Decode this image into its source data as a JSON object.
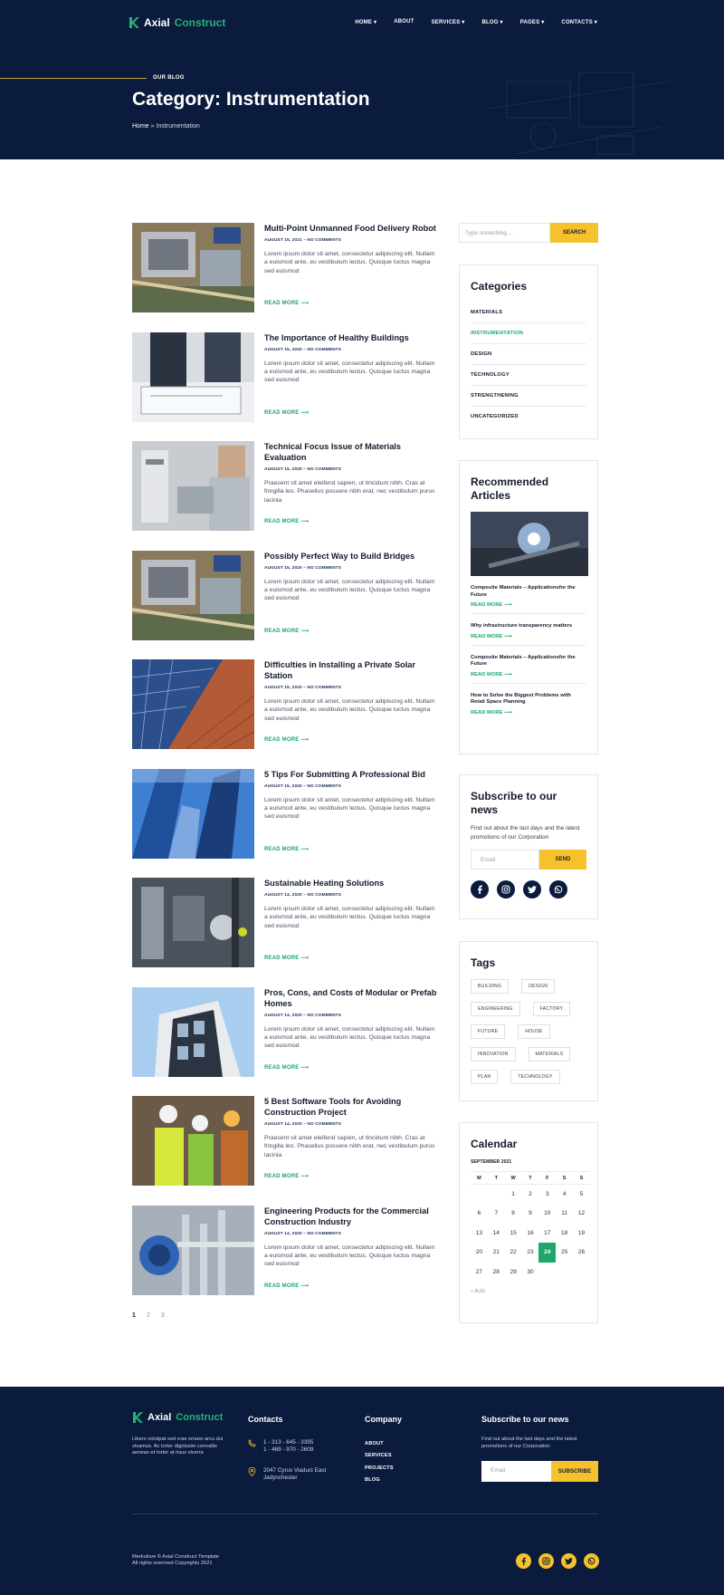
{
  "brand": {
    "name_part1": "Axial",
    "name_part2": "Construct"
  },
  "nav": {
    "home": "HOME",
    "about": "ABOUT",
    "services": "SERVICES",
    "blog": "BLOG",
    "pages": "PAGES",
    "contacts": "CONTACTS"
  },
  "hero": {
    "eyebrow": "OUR BLOG",
    "title": "Category: Instrumentation",
    "breadcrumb_home": "Home",
    "breadcrumb_sep": "»",
    "breadcrumb_current": "Instrumentation"
  },
  "posts": [
    {
      "title": "Multi-Point Unmanned Food Delivery Robot",
      "date": "AUGUST 15, 2021",
      "comments": "NO COMMENTS",
      "excerpt": "Lorem ipsum dolor sit amet, consectetur adipiscing elit. Nullam a euismod ante, eu vestibulum lectus. Quisque luctus magna sed euismod",
      "more": "READ MORE"
    },
    {
      "title": "The Importance of Healthy Buildings",
      "date": "AUGUST 15, 2020",
      "comments": "NO COMMENTS",
      "excerpt": "Lorem ipsum dolor sit amet, consectetur adipiscing elit. Nullam a euismod ante, eu vestibulum lectus. Quisque luctus magna sed euismod",
      "more": "READ MORE"
    },
    {
      "title": "Technical Focus Issue of Materials Evaluation",
      "date": "AUGUST 15, 2020",
      "comments": "NO COMMENTS",
      "excerpt": "Praesent sit amet eleifend sapien, ut tincidunt nibh. Cras at fringilla leo. Phasellus posuere nibh erat, nec vestibulum purus lacinia",
      "more": "READ MORE"
    },
    {
      "title": "Possibly Perfect Way to Build Bridges",
      "date": "AUGUST 15, 2020",
      "comments": "NO COMMENTS",
      "excerpt": "Lorem ipsum dolor sit amet, consectetur adipiscing elit. Nullam a euismod ante, eu vestibulum lectus. Quisque luctus magna sed euismod",
      "more": "READ MORE"
    },
    {
      "title": "Difficulties in Installing a Private Solar Station",
      "date": "AUGUST 15, 2020",
      "comments": "NO COMMENTS",
      "excerpt": "Lorem ipsum dolor sit amet, consectetur adipiscing elit. Nullam a euismod ante, eu vestibulum lectus. Quisque luctus magna sed euismod",
      "more": "READ MORE"
    },
    {
      "title": "5 Tips For Submitting A Professional Bid",
      "date": "AUGUST 15, 2020",
      "comments": "NO COMMENTS",
      "excerpt": "Lorem ipsum dolor sit amet, consectetur adipiscing elit. Nullam a euismod ante, eu vestibulum lectus. Quisque luctus magna sed euismod",
      "more": "READ MORE"
    },
    {
      "title": "Sustainable Heating Solutions",
      "date": "AUGUST 14, 2020",
      "comments": "NO COMMENTS",
      "excerpt": "Lorem ipsum dolor sit amet, consectetur adipiscing elit. Nullam a euismod ante, eu vestibulum lectus. Quisque luctus magna sed euismod",
      "more": "READ MORE"
    },
    {
      "title": "Pros, Cons, and Costs of Modular or Prefab Homes",
      "date": "AUGUST 14, 2020",
      "comments": "NO COMMENTS",
      "excerpt": "Lorem ipsum dolor sit amet, consectetur adipiscing elit. Nullam a euismod ante, eu vestibulum lectus. Quisque luctus magna sed euismod",
      "more": "READ MORE"
    },
    {
      "title": "5 Best Software Tools for Avoiding Construction Project",
      "date": "AUGUST 14, 2020",
      "comments": "NO COMMENTS",
      "excerpt": "Praesent sit amet eleifend sapien, ut tincidunt nibh. Cras at fringilla leo. Phasellus posuere nibh erat, nec vestibulum purus lacinia",
      "more": "READ MORE"
    },
    {
      "title": "Engineering Products for the Commercial Construction Industry",
      "date": "AUGUST 14, 2020",
      "comments": "NO COMMENTS",
      "excerpt": "Lorem ipsum dolor sit amet, consectetur adipiscing elit. Nullam a euismod ante, eu vestibulum lectus. Quisque luctus magna sed euismod",
      "more": "READ MORE"
    }
  ],
  "pagination": [
    "1",
    "2",
    "3"
  ],
  "search": {
    "placeholder": "Type something ...",
    "button": "SEARCH"
  },
  "categories": {
    "title": "Categories",
    "items": [
      "MATERIALS",
      "INSTRUMENTATION",
      "DESIGN",
      "TECHNOLOGY",
      "STRENGTHENING",
      "UNCATEGORIZED"
    ]
  },
  "recommended": {
    "title": "Recommended Articles",
    "more": "READ MORE",
    "items": [
      "Composite Materials – Applicationsfor the Future",
      "Why infrastructure transparency matters",
      "Composite Materials – Applicationsfor the Future",
      "How to Solve the Biggest Problems with Retail Space Planning"
    ]
  },
  "subscribe": {
    "title": "Subscribe to our news",
    "text": "Find out about the last days and the latest promotions of our Corporation",
    "placeholder": "Email",
    "button": "SEND"
  },
  "tags": {
    "title": "Tags",
    "items": [
      "BUILDING",
      "DESIGN",
      "ENGINEERING",
      "FACTORY",
      "FUTURE",
      "HOUSE",
      "INNOVATION",
      "MATERIALS",
      "PLAN",
      "TECHNOLOGY"
    ]
  },
  "calendar": {
    "title": "Calendar",
    "month": "SEPTEMBER 2021",
    "days": [
      "M",
      "T",
      "W",
      "T",
      "F",
      "S",
      "S"
    ],
    "today": "24",
    "prev": "« AUG",
    "weeks": [
      [
        "",
        "",
        "1",
        "2",
        "3",
        "4",
        "5"
      ],
      [
        "6",
        "7",
        "8",
        "9",
        "10",
        "11",
        "12"
      ],
      [
        "13",
        "14",
        "15",
        "16",
        "17",
        "18",
        "19"
      ],
      [
        "20",
        "21",
        "22",
        "23",
        "24",
        "25",
        "26"
      ],
      [
        "27",
        "28",
        "29",
        "30",
        "",
        "",
        ""
      ]
    ]
  },
  "footer": {
    "desc": "Libero volutpat sed cras ornare arcu dui vivamus. Ac tortor dignissim convallis aenean et tortor at risus viverra",
    "contacts_title": "Contacts",
    "phone1": "1 - 313 - 645 - 3395",
    "phone2": "1 - 469 - 970 - 2609",
    "address": "2047 Cyrus Viaduct East Jadynchester",
    "company_title": "Company",
    "links": [
      "ABOUT",
      "SERVICES",
      "PROJECTS",
      "BLOG"
    ],
    "sub_title": "Subscribe to our news",
    "sub_text": "Find out about the last days and the latest promotions of our Corporation",
    "sub_placeholder": "Email",
    "sub_button": "SUBSCRIBE",
    "copy1": "Merkulove © Axial Construct Template",
    "copy2": "All rights reserved Copyrights 2021"
  },
  "colors": {
    "navy": "#0b1b3d",
    "green": "#1fa66a",
    "yellow": "#f5c22c"
  },
  "icons": {
    "social": [
      "facebook-icon",
      "instagram-icon",
      "twitter-icon",
      "whatsapp-icon"
    ]
  }
}
